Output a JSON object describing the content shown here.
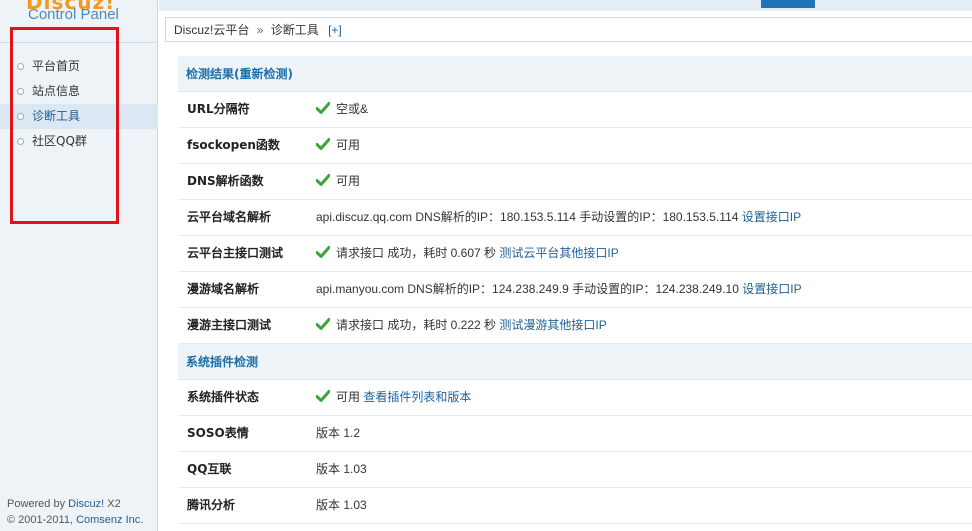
{
  "logo": {
    "brand": "Discuz!",
    "subtitle": "Control Panel"
  },
  "sidebar": {
    "items": [
      {
        "label": "平台首页"
      },
      {
        "label": "站点信息"
      },
      {
        "label": "诊断工具"
      },
      {
        "label": "社区QQ群"
      }
    ],
    "footer_prefix": "Powered by",
    "footer_brand": "Discuz!",
    "footer_version": "X2",
    "footer_copy_prefix": "© 2001-2011,",
    "footer_company": "Comsenz Inc."
  },
  "breadcrumb": {
    "root": "Discuz!云平台",
    "separator": "»",
    "current": "诊断工具",
    "toggle": "[+]"
  },
  "sections": [
    {
      "title": "检测结果(重新检测)",
      "rows": [
        {
          "label": "URL分隔符",
          "check": true,
          "text": "空或&",
          "link": ""
        },
        {
          "label": "fsockopen函数",
          "check": true,
          "text": "可用",
          "link": ""
        },
        {
          "label": "DNS解析函数",
          "check": true,
          "text": "可用",
          "link": ""
        },
        {
          "label": "云平台域名解析",
          "check": false,
          "text": "api.discuz.qq.com DNS解析的IP：180.153.5.114 手动设置的IP：180.153.5.114",
          "link": "设置接口IP"
        },
        {
          "label": "云平台主接口测试",
          "check": true,
          "text": "请求接口 成功，耗时 0.607 秒",
          "link": "测试云平台其他接口IP"
        },
        {
          "label": "漫游域名解析",
          "check": false,
          "text": "api.manyou.com DNS解析的IP：124.238.249.9 手动设置的IP：124.238.249.10",
          "link": "设置接口IP"
        },
        {
          "label": "漫游主接口测试",
          "check": true,
          "text": "请求接口 成功，耗时 0.222 秒",
          "link": "测试漫游其他接口IP"
        }
      ]
    },
    {
      "title": "系统插件检测",
      "rows": [
        {
          "label": "系统插件状态",
          "check": true,
          "text": "可用",
          "link": "查看插件列表和版本"
        },
        {
          "label": "SOSO表情",
          "check": false,
          "text": "版本 1.2",
          "link": ""
        },
        {
          "label": "QQ互联",
          "check": false,
          "text": "版本 1.03",
          "link": ""
        },
        {
          "label": "腾讯分析",
          "check": false,
          "text": "版本 1.03",
          "link": ""
        }
      ]
    }
  ],
  "colors": {
    "accent": "#1f74b8",
    "check": "#3aa33a",
    "highlight": "#e0141b"
  },
  "icons": {
    "check": "check-icon",
    "bullet": "bullet-icon"
  }
}
